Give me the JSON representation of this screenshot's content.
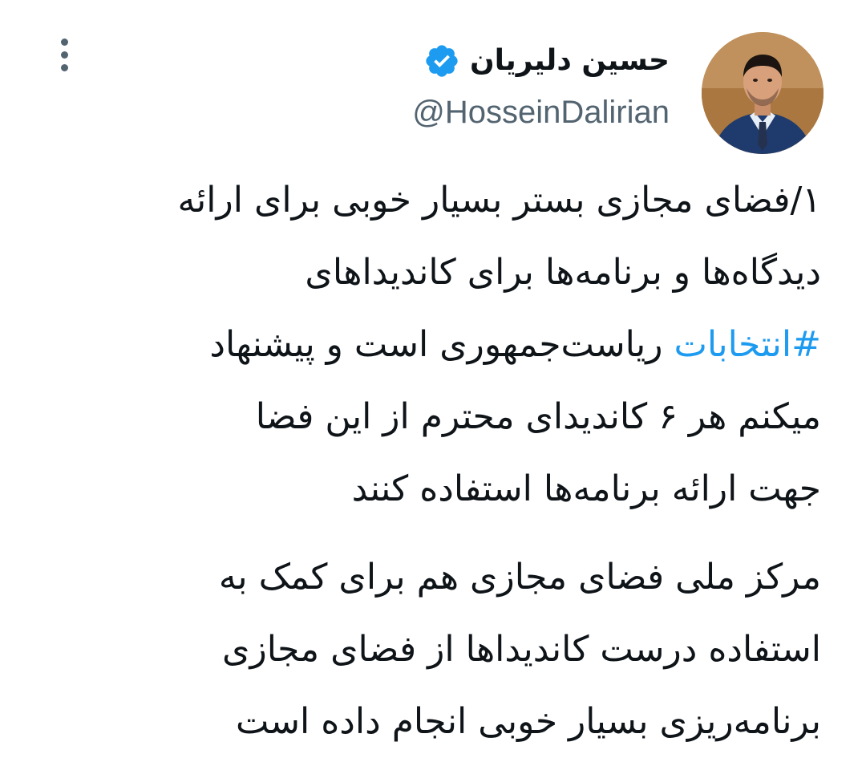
{
  "author": {
    "display_name": "حسین دلیریان",
    "handle": "@HosseinDalirian",
    "verified": true,
    "verified_color": "#1d9bf0",
    "avatar_icon": "profile-photo"
  },
  "actions": {
    "more_icon": "more-vertical-icon"
  },
  "tweet": {
    "hashtag_color": "#1d9bf0",
    "paragraph1": {
      "line1": "۱/فضای مجازی بستر بسیار خوبی برای ارائه",
      "line2": "دیدگاه‌ها و برنامه‌ها برای کاندیداهای",
      "line3_hashtag": "#انتخابات",
      "line3_rest": " ریاست‌جمهوری است و پیشنهاد",
      "line4": "میکنم هر ۶ کاندیدای محترم از این فضا",
      "line5": "جهت ارائه برنامه‌ها استفاده کنند"
    },
    "paragraph2": {
      "line1": "مرکز ملی فضای مجازی هم برای کمک به",
      "line2": "استفاده درست کاندیداها از فضای مجازی",
      "line3": "برنامه‌ریزی بسیار خوبی انجام داده است"
    }
  }
}
